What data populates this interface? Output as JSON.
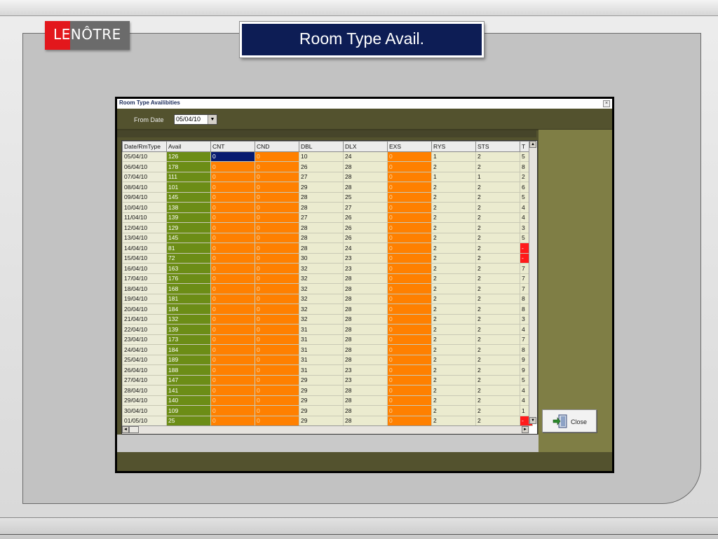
{
  "slide": {
    "logo_left": "LE",
    "logo_right": "NÔTRE",
    "title": "Room Type Avail."
  },
  "window": {
    "title": "Room Type Availibities",
    "close_glyph": "×",
    "from_date_label": "From Date",
    "from_date_value": "05/04/10",
    "close_button_label": "Close"
  },
  "grid": {
    "columns": [
      "Date/RmType",
      "Avail",
      "CNT",
      "CND",
      "DBL",
      "DLX",
      "EXS",
      "RYS",
      "STS",
      "T"
    ],
    "rows": [
      [
        "05/04/10",
        "126",
        "0",
        "0",
        "10",
        "24",
        "0",
        "1",
        "2",
        "5"
      ],
      [
        "06/04/10",
        "178",
        "0",
        "0",
        "26",
        "28",
        "0",
        "2",
        "2",
        "8"
      ],
      [
        "07/04/10",
        "111",
        "0",
        "0",
        "27",
        "28",
        "0",
        "1",
        "1",
        "2"
      ],
      [
        "08/04/10",
        "101",
        "0",
        "0",
        "29",
        "28",
        "0",
        "2",
        "2",
        "6"
      ],
      [
        "09/04/10",
        "145",
        "0",
        "0",
        "28",
        "25",
        "0",
        "2",
        "2",
        "5"
      ],
      [
        "10/04/10",
        "138",
        "0",
        "0",
        "28",
        "27",
        "0",
        "2",
        "2",
        "4"
      ],
      [
        "11/04/10",
        "139",
        "0",
        "0",
        "27",
        "26",
        "0",
        "2",
        "2",
        "4"
      ],
      [
        "12/04/10",
        "129",
        "0",
        "0",
        "28",
        "26",
        "0",
        "2",
        "2",
        "3"
      ],
      [
        "13/04/10",
        "145",
        "0",
        "0",
        "28",
        "26",
        "0",
        "2",
        "2",
        "5"
      ],
      [
        "14/04/10",
        "81",
        "0",
        "0",
        "28",
        "24",
        "0",
        "2",
        "2",
        "-"
      ],
      [
        "15/04/10",
        "72",
        "0",
        "0",
        "30",
        "23",
        "0",
        "2",
        "2",
        "-"
      ],
      [
        "16/04/10",
        "163",
        "0",
        "0",
        "32",
        "23",
        "0",
        "2",
        "2",
        "7"
      ],
      [
        "17/04/10",
        "176",
        "0",
        "0",
        "32",
        "28",
        "0",
        "2",
        "2",
        "7"
      ],
      [
        "18/04/10",
        "168",
        "0",
        "0",
        "32",
        "28",
        "0",
        "2",
        "2",
        "7"
      ],
      [
        "19/04/10",
        "181",
        "0",
        "0",
        "32",
        "28",
        "0",
        "2",
        "2",
        "8"
      ],
      [
        "20/04/10",
        "184",
        "0",
        "0",
        "32",
        "28",
        "0",
        "2",
        "2",
        "8"
      ],
      [
        "21/04/10",
        "132",
        "0",
        "0",
        "32",
        "28",
        "0",
        "2",
        "2",
        "3"
      ],
      [
        "22/04/10",
        "139",
        "0",
        "0",
        "31",
        "28",
        "0",
        "2",
        "2",
        "4"
      ],
      [
        "23/04/10",
        "173",
        "0",
        "0",
        "31",
        "28",
        "0",
        "2",
        "2",
        "7"
      ],
      [
        "24/04/10",
        "184",
        "0",
        "0",
        "31",
        "28",
        "0",
        "2",
        "2",
        "8"
      ],
      [
        "25/04/10",
        "189",
        "0",
        "0",
        "31",
        "28",
        "0",
        "2",
        "2",
        "9"
      ],
      [
        "26/04/10",
        "188",
        "0",
        "0",
        "31",
        "23",
        "0",
        "2",
        "2",
        "9"
      ],
      [
        "27/04/10",
        "147",
        "0",
        "0",
        "29",
        "23",
        "0",
        "2",
        "2",
        "5"
      ],
      [
        "28/04/10",
        "141",
        "0",
        "0",
        "29",
        "28",
        "0",
        "2",
        "2",
        "4"
      ],
      [
        "29/04/10",
        "140",
        "0",
        "0",
        "29",
        "28",
        "0",
        "2",
        "2",
        "4"
      ],
      [
        "30/04/10",
        "109",
        "0",
        "0",
        "29",
        "28",
        "0",
        "2",
        "2",
        "1"
      ],
      [
        "01/05/10",
        "25",
        "0",
        "0",
        "29",
        "28",
        "0",
        "2",
        "2",
        "-"
      ]
    ],
    "negative_rows": [
      9,
      10,
      26
    ],
    "selected_cell": [
      0,
      2
    ]
  },
  "colors": {
    "avail": "#6c8d16",
    "zero_col": "#ff8000",
    "cream": "#ebebcf",
    "negative": "#ff1a1a",
    "title_bg": "#0d1d55"
  }
}
